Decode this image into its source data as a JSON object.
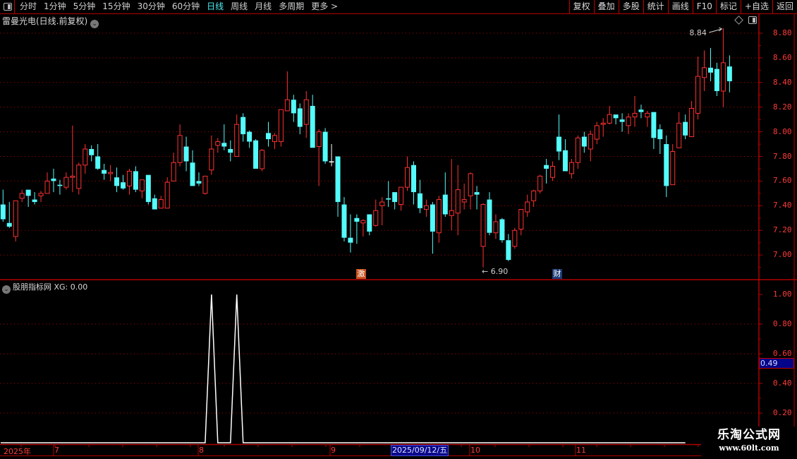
{
  "toolbar": {
    "periods": [
      "分时",
      "1分钟",
      "5分钟",
      "15分钟",
      "30分钟",
      "60分钟",
      "日线",
      "周线",
      "月线",
      "多周期",
      "更多 >"
    ],
    "active_period": "日线",
    "buttons": [
      "复权",
      "叠加",
      "多股",
      "统计",
      "画线",
      "F10",
      "标记",
      "+自选",
      "返回"
    ]
  },
  "main": {
    "title": "雷曼光电(日线.前复权)",
    "high_label": "8.84",
    "low_label": "6.90",
    "badges": [
      {
        "text": "激",
        "color": "#c8501e"
      },
      {
        "text": "财",
        "color": "#1c3c78"
      }
    ]
  },
  "indicator": {
    "title": "股朋指标网",
    "value_label": "XG: 0.00",
    "readout": "0.49"
  },
  "time_axis": {
    "labels": [
      "2025年",
      "7",
      "8",
      "9",
      "10",
      "11"
    ],
    "cursor_date": "2025/09/12/五"
  },
  "watermark": {
    "line1": "乐淘公式网",
    "line2": "www.60lt.com"
  },
  "colors": {
    "up": "#ff3232",
    "down": "#54fcfc",
    "flat": "#ffffff",
    "grid": "#b00000",
    "axis": "#ff3a3a",
    "active": "#4ef0f5"
  },
  "chart_data": [
    {
      "type": "candlestick",
      "ylim": [
        6.85,
        8.9
      ],
      "yticks": [
        8.8,
        8.6,
        8.4,
        8.2,
        8.0,
        7.8,
        7.6,
        7.4,
        7.2,
        7.0
      ],
      "grid": true,
      "ohlc_fields": [
        "open",
        "high",
        "low",
        "close"
      ],
      "ohlc": [
        [
          7.41,
          7.53,
          7.27,
          7.29
        ],
        [
          7.26,
          7.43,
          7.22,
          7.23
        ],
        [
          7.15,
          7.44,
          7.11,
          7.44
        ],
        [
          7.46,
          7.53,
          7.43,
          7.5
        ],
        [
          7.53,
          7.53,
          7.39,
          7.48
        ],
        [
          7.45,
          7.51,
          7.41,
          7.43
        ],
        [
          7.48,
          7.52,
          7.43,
          7.5
        ],
        [
          7.5,
          7.67,
          7.5,
          7.6
        ],
        [
          7.62,
          7.7,
          7.51,
          7.6
        ],
        [
          7.57,
          7.61,
          7.49,
          7.56
        ],
        [
          7.55,
          7.67,
          7.53,
          7.63
        ],
        [
          7.63,
          8.05,
          7.51,
          7.64
        ],
        [
          7.54,
          7.75,
          7.49,
          7.73
        ],
        [
          7.73,
          7.9,
          7.66,
          7.86
        ],
        [
          7.86,
          7.89,
          7.76,
          7.81
        ],
        [
          7.8,
          7.9,
          7.69,
          7.7
        ],
        [
          7.69,
          7.74,
          7.61,
          7.66
        ],
        [
          7.66,
          7.73,
          7.6,
          7.67
        ],
        [
          7.63,
          7.71,
          7.51,
          7.56
        ],
        [
          7.59,
          7.65,
          7.53,
          7.54
        ],
        [
          7.56,
          7.7,
          7.49,
          7.68
        ],
        [
          7.68,
          7.72,
          7.51,
          7.53
        ],
        [
          7.52,
          7.61,
          7.46,
          7.61
        ],
        [
          7.65,
          7.65,
          7.41,
          7.43
        ],
        [
          7.46,
          7.49,
          7.37,
          7.37
        ],
        [
          7.38,
          7.48,
          7.38,
          7.45
        ],
        [
          7.38,
          7.63,
          7.38,
          7.59
        ],
        [
          7.6,
          7.83,
          7.6,
          7.75
        ],
        [
          7.75,
          8.06,
          7.72,
          7.97
        ],
        [
          7.88,
          7.96,
          7.68,
          7.76
        ],
        [
          7.75,
          7.85,
          7.56,
          7.56
        ],
        [
          7.6,
          7.67,
          7.56,
          7.58
        ],
        [
          7.5,
          7.64,
          7.49,
          7.64
        ],
        [
          7.69,
          7.97,
          7.65,
          7.86
        ],
        [
          7.89,
          7.95,
          7.83,
          7.92
        ],
        [
          7.91,
          8.06,
          7.85,
          7.88
        ],
        [
          7.86,
          7.93,
          7.76,
          7.83
        ],
        [
          7.8,
          8.14,
          7.8,
          8.06
        ],
        [
          8.12,
          8.15,
          7.92,
          7.98
        ],
        [
          8.0,
          8.01,
          7.87,
          7.92
        ],
        [
          7.93,
          7.94,
          7.7,
          7.7
        ],
        [
          7.7,
          7.86,
          7.68,
          7.85
        ],
        [
          7.99,
          8.08,
          7.88,
          7.94
        ],
        [
          7.92,
          7.99,
          7.86,
          7.97
        ],
        [
          7.92,
          8.18,
          7.88,
          8.18
        ],
        [
          8.17,
          8.49,
          8.17,
          8.26
        ],
        [
          8.26,
          8.3,
          8.08,
          8.15
        ],
        [
          8.19,
          8.23,
          7.98,
          8.04
        ],
        [
          8.06,
          8.33,
          7.95,
          8.26
        ],
        [
          8.21,
          8.3,
          7.87,
          7.87
        ],
        [
          7.88,
          8.02,
          7.56,
          8.0
        ],
        [
          8.0,
          8.03,
          7.74,
          7.76
        ],
        [
          7.76,
          7.9,
          7.72,
          7.76
        ],
        [
          7.8,
          7.8,
          7.31,
          7.43
        ],
        [
          7.41,
          7.47,
          7.11,
          7.14
        ],
        [
          7.14,
          7.33,
          7.02,
          7.1
        ],
        [
          7.3,
          7.33,
          7.09,
          7.27
        ],
        [
          7.26,
          7.29,
          7.15,
          7.28
        ],
        [
          7.33,
          7.33,
          7.16,
          7.19
        ],
        [
          7.24,
          7.45,
          7.23,
          7.36
        ],
        [
          7.4,
          7.47,
          7.24,
          7.43
        ],
        [
          7.46,
          7.6,
          7.39,
          7.45
        ],
        [
          7.51,
          7.51,
          7.37,
          7.43
        ],
        [
          7.41,
          7.55,
          7.36,
          7.55
        ],
        [
          7.55,
          7.8,
          7.52,
          7.71
        ],
        [
          7.73,
          7.76,
          7.41,
          7.51
        ],
        [
          7.5,
          7.61,
          7.34,
          7.38
        ],
        [
          7.37,
          7.45,
          7.31,
          7.4
        ],
        [
          7.41,
          7.43,
          7.01,
          7.19
        ],
        [
          7.18,
          7.48,
          7.1,
          7.45
        ],
        [
          7.49,
          7.67,
          7.31,
          7.33
        ],
        [
          7.32,
          7.78,
          7.2,
          7.36
        ],
        [
          7.34,
          7.73,
          7.16,
          7.53
        ],
        [
          7.43,
          7.58,
          7.37,
          7.45
        ],
        [
          7.48,
          7.67,
          7.37,
          7.66
        ],
        [
          7.51,
          7.56,
          7.37,
          7.49
        ],
        [
          7.07,
          7.42,
          6.9,
          7.41
        ],
        [
          7.45,
          7.51,
          7.16,
          7.18
        ],
        [
          7.18,
          7.33,
          7.13,
          7.27
        ],
        [
          7.29,
          7.3,
          7.1,
          7.12
        ],
        [
          7.12,
          7.17,
          6.95,
          6.96
        ],
        [
          7.07,
          7.22,
          7.05,
          7.2
        ],
        [
          7.21,
          7.37,
          7.16,
          7.37
        ],
        [
          7.35,
          7.49,
          7.31,
          7.43
        ],
        [
          7.44,
          7.53,
          7.39,
          7.52
        ],
        [
          7.52,
          7.65,
          7.5,
          7.64
        ],
        [
          7.73,
          7.78,
          7.58,
          7.7
        ],
        [
          7.63,
          7.76,
          7.6,
          7.72
        ],
        [
          7.96,
          8.14,
          7.77,
          7.84
        ],
        [
          7.85,
          7.94,
          7.68,
          7.68
        ],
        [
          7.66,
          7.78,
          7.62,
          7.75
        ],
        [
          7.75,
          7.97,
          7.7,
          7.95
        ],
        [
          7.96,
          8.0,
          7.83,
          7.88
        ],
        [
          7.86,
          8.01,
          7.76,
          7.98
        ],
        [
          7.94,
          8.08,
          7.9,
          8.05
        ],
        [
          8.06,
          8.11,
          7.96,
          8.07
        ],
        [
          8.07,
          8.21,
          8.06,
          8.14
        ],
        [
          8.14,
          8.14,
          8.06,
          8.11
        ],
        [
          8.1,
          8.15,
          8.0,
          8.08
        ],
        [
          8.05,
          8.15,
          7.98,
          8.12
        ],
        [
          8.12,
          8.29,
          8.04,
          8.15
        ],
        [
          8.18,
          8.22,
          8.11,
          8.16
        ],
        [
          8.12,
          8.17,
          8.04,
          8.15
        ],
        [
          8.16,
          8.16,
          7.86,
          7.95
        ],
        [
          8.02,
          8.06,
          7.82,
          7.94
        ],
        [
          7.9,
          7.97,
          7.47,
          7.56
        ],
        [
          7.57,
          7.9,
          7.57,
          7.84
        ],
        [
          7.87,
          8.16,
          7.87,
          8.07
        ],
        [
          8.08,
          8.14,
          7.94,
          7.97
        ],
        [
          7.96,
          8.25,
          7.96,
          8.19
        ],
        [
          8.15,
          8.61,
          8.1,
          8.45
        ],
        [
          8.44,
          8.66,
          8.33,
          8.52
        ],
        [
          8.52,
          8.68,
          8.41,
          8.48
        ],
        [
          8.51,
          8.56,
          8.29,
          8.33
        ],
        [
          8.33,
          8.84,
          8.2,
          8.56
        ],
        [
          8.53,
          8.62,
          8.32,
          8.41
        ]
      ],
      "max_high": 8.84,
      "min_low": 6.9
    },
    {
      "type": "line",
      "series": [
        {
          "name": "XG",
          "values": [
            0,
            0,
            0,
            0,
            0,
            0,
            0,
            0,
            0,
            0,
            0,
            0,
            0,
            0,
            0,
            0,
            0,
            0,
            0,
            0,
            0,
            0,
            0,
            0,
            0,
            0,
            0,
            0,
            0,
            0,
            0,
            0,
            0,
            1,
            0,
            0,
            0,
            1,
            0,
            0,
            0,
            0,
            0,
            0,
            0,
            0,
            0,
            0,
            0,
            0,
            0,
            0,
            0,
            0,
            0,
            0,
            0,
            0,
            0,
            0,
            0,
            0,
            0,
            0,
            0,
            0,
            0,
            0,
            0,
            0,
            0,
            0,
            0,
            0,
            0,
            0,
            0,
            0,
            0,
            0,
            0,
            0,
            0,
            0,
            0,
            0,
            0,
            0,
            0,
            0,
            0,
            0,
            0,
            0,
            0,
            0,
            0,
            0,
            0,
            0,
            0,
            0,
            0,
            0,
            0,
            0,
            0,
            0,
            0
          ]
        }
      ],
      "ylim": [
        0,
        1.0
      ],
      "yticks": [
        1.0,
        0.8,
        0.6,
        0.4,
        0.2
      ],
      "grid": true
    }
  ]
}
